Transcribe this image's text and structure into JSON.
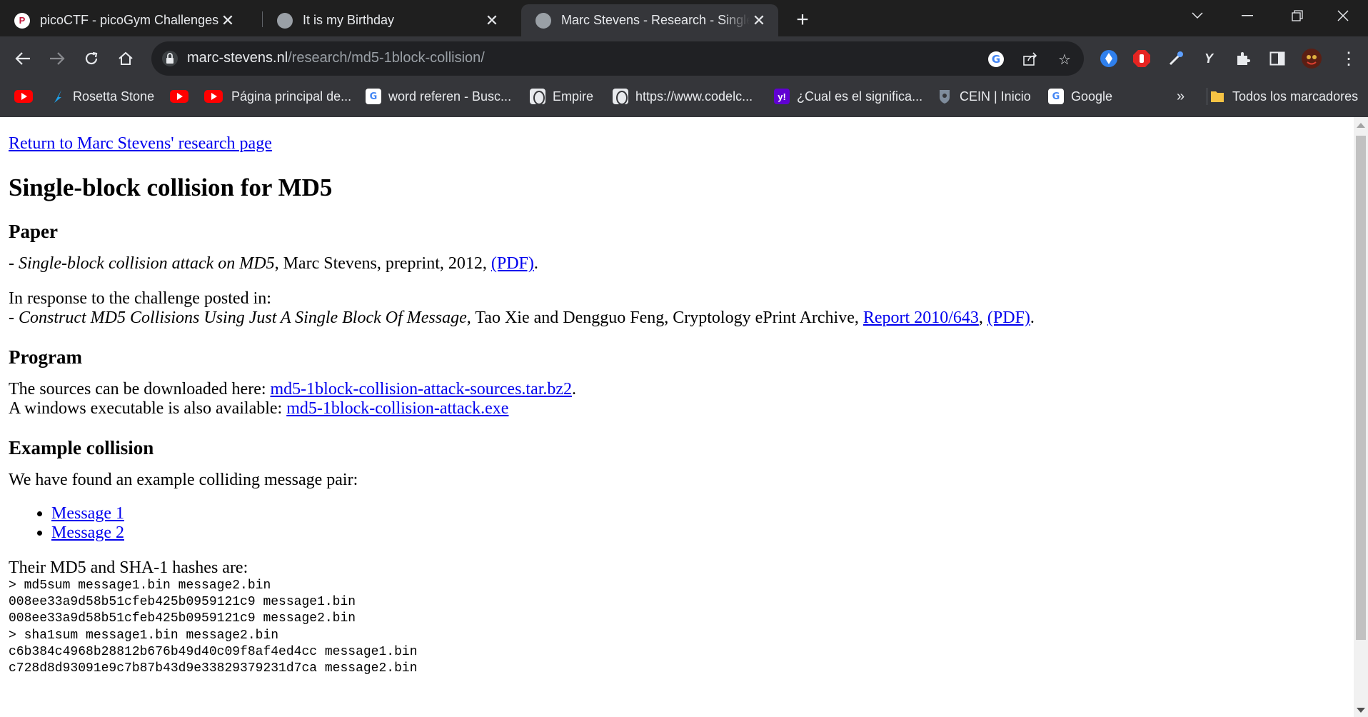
{
  "tabs": [
    {
      "title": "picoCTF - picoGym Challenges",
      "favicon": "picoctf-icon",
      "favicon_letter": "P",
      "active": false
    },
    {
      "title": "It is my Birthday",
      "favicon": "globe-icon",
      "active": false
    },
    {
      "title": "Marc Stevens - Research - Single-block",
      "favicon": "globe-icon",
      "active": true
    }
  ],
  "address_bar": {
    "host": "marc-stevens.nl",
    "path": "/research/md5-1block-collision/"
  },
  "bookmarks": [
    {
      "label": "",
      "icon": "youtube-icon"
    },
    {
      "label": "Rosetta Stone",
      "icon": "rosetta-icon"
    },
    {
      "label": "",
      "icon": "youtube-icon"
    },
    {
      "label": "Página principal de...",
      "icon": "youtube-icon"
    },
    {
      "label": "word referen - Busc...",
      "icon": "google-icon"
    },
    {
      "label": "Empire",
      "icon": "globe-icon"
    },
    {
      "label": "https://www.codelc...",
      "icon": "globe-icon"
    },
    {
      "label": "¿Cual es el significa...",
      "icon": "yahoo-icon",
      "icon_text": "y!"
    },
    {
      "label": "CEIN | Inicio",
      "icon": "cein-icon"
    },
    {
      "label": "Google",
      "icon": "google-icon"
    }
  ],
  "bookmarks_overflow": "»",
  "all_bookmarks_label": "Todos los marcadores",
  "content": {
    "return_link": "Return to Marc Stevens' research page",
    "title": "Single-block collision for MD5",
    "paper_heading": "Paper",
    "paper_prefix": "- ",
    "paper_title": "Single-block collision attack on MD5",
    "paper_rest": ", Marc Stevens, preprint, 2012, ",
    "paper_pdf": "(PDF)",
    "paper_end": ".",
    "response_intro": "In response to the challenge posted in:",
    "response_prefix": "- ",
    "response_title": "Construct MD5 Collisions Using Just A Single Block Of Message",
    "response_rest": ", Tao Xie and Dengguo Feng, Cryptology ePrint Archive, ",
    "response_report": "Report 2010/643",
    "response_comma": ", ",
    "response_pdf": "(PDF)",
    "response_end": ".",
    "program_heading": "Program",
    "sources_text": "The sources can be downloaded here: ",
    "sources_link": "md5-1block-collision-attack-sources.tar.bz2",
    "sources_end": ".",
    "exe_text": "A windows executable is also available: ",
    "exe_link": "md5-1block-collision-attack.exe",
    "example_heading": "Example collision",
    "example_text": "We have found an example colliding message pair:",
    "messages": [
      "Message 1",
      "Message 2"
    ],
    "hashes_intro": "Their MD5 and SHA-1 hashes are:",
    "terminal_lines": [
      "> md5sum message1.bin message2.bin",
      "008ee33a9d58b51cfeb425b0959121c9 message1.bin",
      "008ee33a9d58b51cfeb425b0959121c9 message2.bin",
      "> sha1sum message1.bin message2.bin",
      "c6b384c4968b28812b676b49d40c09f8af4ed4cc message1.bin",
      "c728d8d93091e9c7b87b43d9e33829379231d7ca message2.bin"
    ]
  }
}
